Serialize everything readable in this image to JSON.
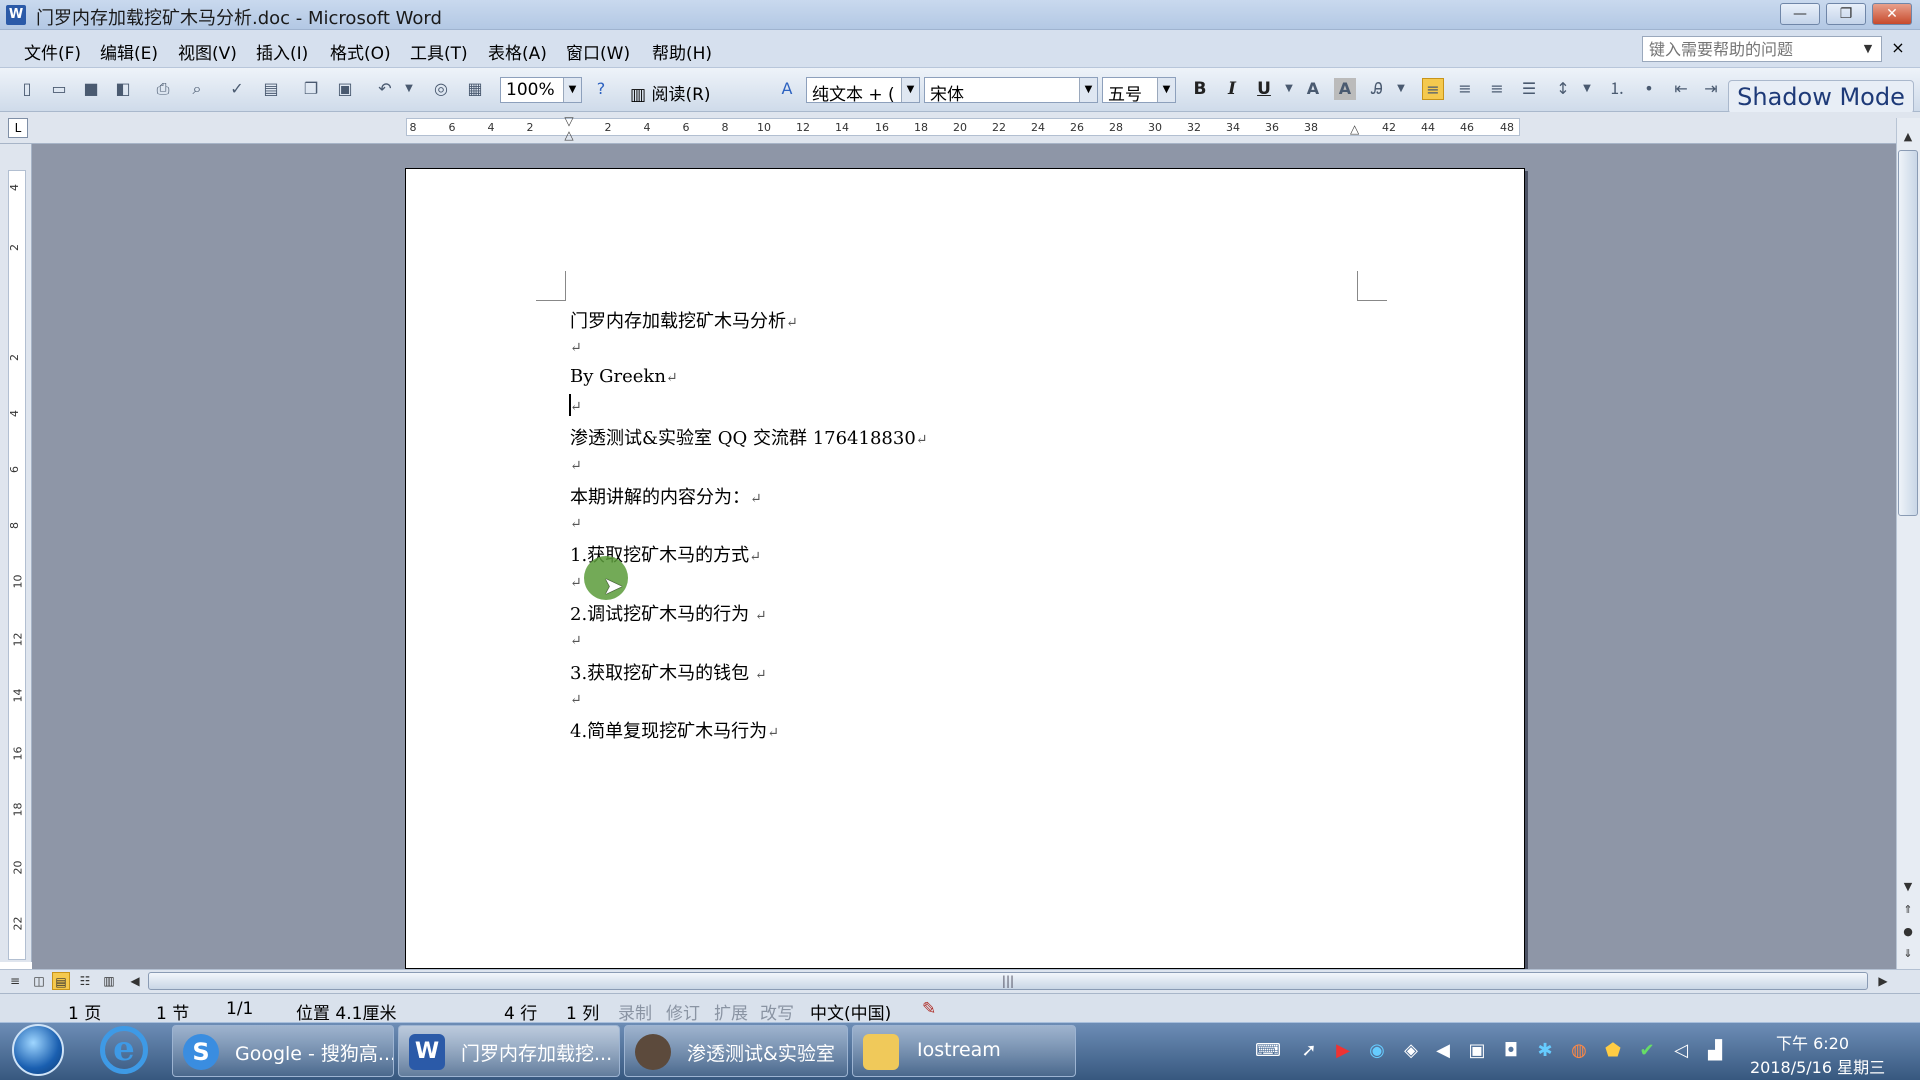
{
  "window": {
    "title": "门罗内存加载挖矿木马分析.doc - Microsoft Word",
    "minimize": "—",
    "restore": "❐",
    "close": "✕"
  },
  "menu": {
    "items": [
      "文件(F)",
      "编辑(E)",
      "视图(V)",
      "插入(I)",
      "格式(O)",
      "工具(T)",
      "表格(A)",
      "窗口(W)",
      "帮助(H)"
    ],
    "help_placeholder": "键入需要帮助的问题"
  },
  "toolbar": {
    "zoom": "100%",
    "read_label": "阅读(R)",
    "style": "纯文本 + (",
    "font": "宋体",
    "font_size": "五号",
    "bold": "B",
    "italic": "I",
    "underline": "U"
  },
  "overlay": {
    "shadow_mode": "Shadow Mode"
  },
  "ruler": {
    "h_ticks": [
      "8",
      "6",
      "4",
      "2",
      "2",
      "4",
      "6",
      "8",
      "10",
      "12",
      "14",
      "16",
      "18",
      "20",
      "22",
      "24",
      "26",
      "28",
      "30",
      "32",
      "34",
      "36",
      "38",
      "42",
      "44",
      "46",
      "48"
    ],
    "v_ticks": [
      "4",
      "2",
      "2",
      "4",
      "6",
      "8",
      "10",
      "12",
      "14",
      "16",
      "18",
      "20",
      "22"
    ]
  },
  "document": {
    "lines": [
      {
        "text": "门罗内存加载挖矿木马分析",
        "mark": "↵"
      },
      {
        "text": "",
        "mark": "↵"
      },
      {
        "text": "By Greekn",
        "mark": "↵"
      },
      {
        "text": "",
        "mark": "↵"
      },
      {
        "text": "渗透测试&实验室 QQ 交流群 176418830",
        "mark": "↵"
      },
      {
        "text": "",
        "mark": "↵"
      },
      {
        "text": "本期讲解的内容分为：",
        "mark": "↵"
      },
      {
        "text": "",
        "mark": "↵"
      },
      {
        "text": "1.获取挖矿木马的方式",
        "mark": "↵"
      },
      {
        "text": "",
        "mark": "↵"
      },
      {
        "text": "2.调试挖矿木马的行为 ",
        "mark": "↵"
      },
      {
        "text": "",
        "mark": "↵"
      },
      {
        "text": "3.获取挖矿木马的钱包  ",
        "mark": "↵"
      },
      {
        "text": "",
        "mark": "↵"
      },
      {
        "text": "4.简单复现挖矿木马行为",
        "mark": "↵"
      }
    ]
  },
  "statusbar": {
    "page": "1 页",
    "section": "1 节",
    "page_of": "1/1",
    "position": "位置 4.1厘米",
    "line": "4 行",
    "column": "1 列",
    "rec": "录制",
    "trk": "修订",
    "ext": "扩展",
    "ovr": "改写",
    "language": "中文(中国)"
  },
  "taskbar": {
    "items": [
      {
        "label": "Google - 搜狗高..."
      },
      {
        "label": "门罗内存加载挖..."
      },
      {
        "label": "渗透测试&实验室"
      },
      {
        "label": "Iostream"
      }
    ],
    "clock_time": "下午 6:20",
    "clock_date": "2018/5/16 星期三"
  }
}
